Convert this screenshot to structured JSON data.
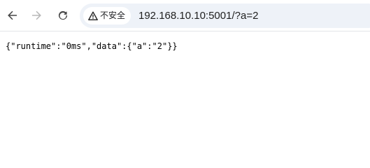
{
  "toolbar": {
    "back_icon": "arrow-left-icon",
    "forward_icon": "arrow-right-icon",
    "reload_icon": "reload-icon",
    "icon_color": "#474747",
    "forward_disabled_color": "#b8b8b8"
  },
  "address_bar": {
    "security_icon": "warning-triangle-icon",
    "security_label": "不安全",
    "url": "192.168.10.10:5001/?a=2",
    "background": "#eef2f8"
  },
  "page": {
    "body_text": "{\"runtime\":\"0ms\",\"data\":{\"a\":\"2\"}}"
  }
}
